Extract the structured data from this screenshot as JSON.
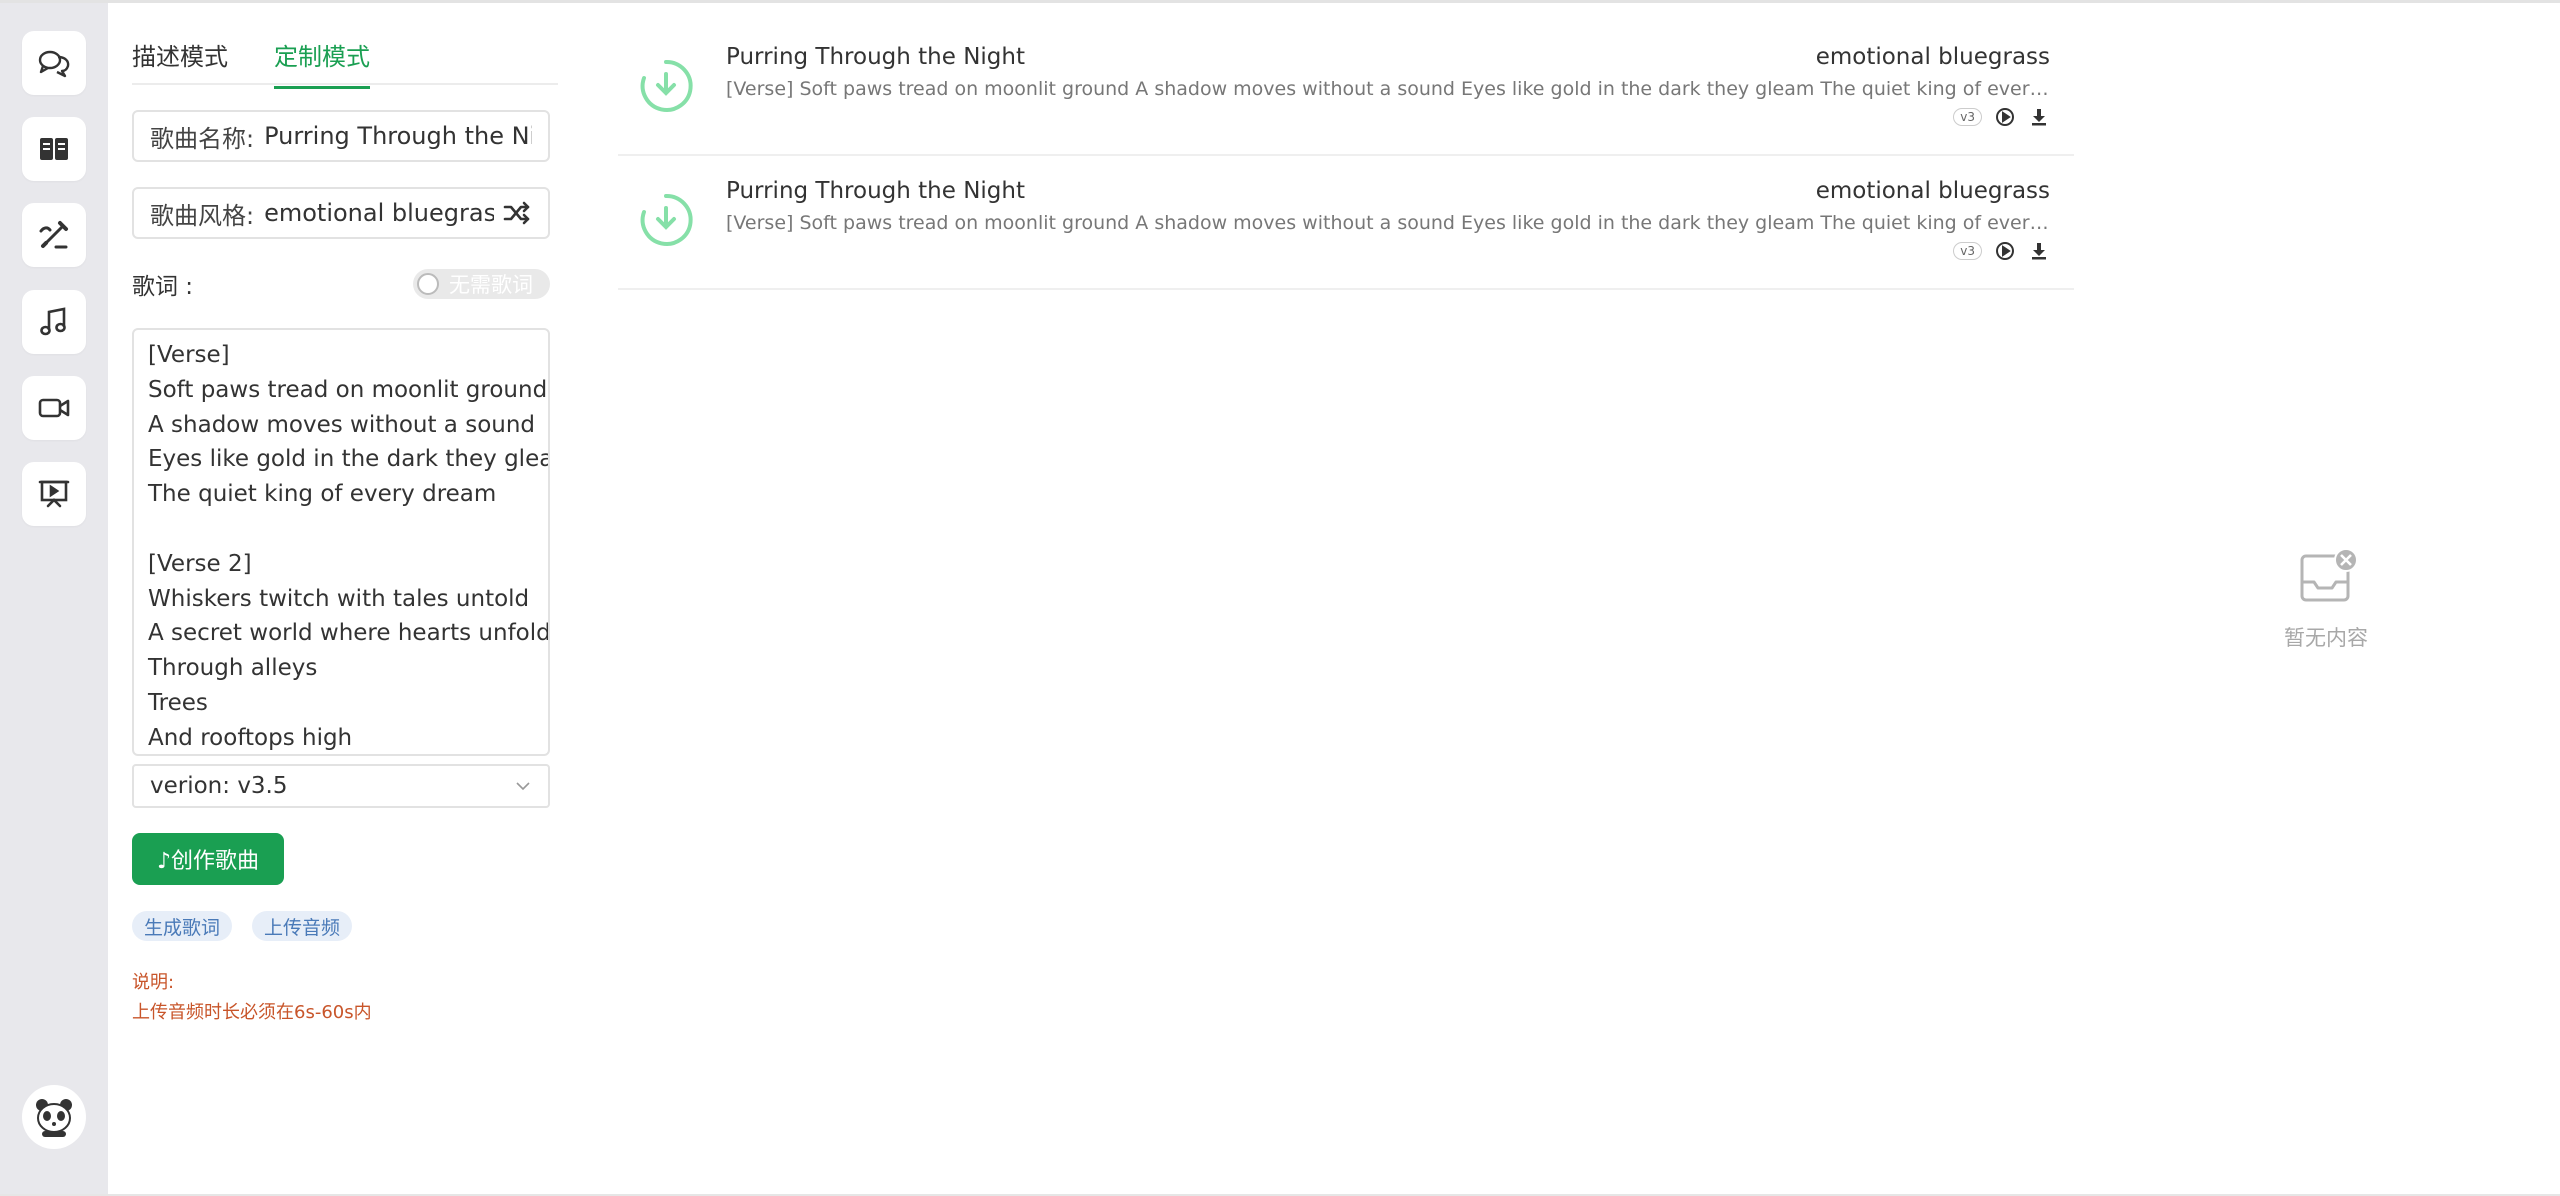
{
  "sidebar": {
    "items": [
      {
        "name": "chat-icon"
      },
      {
        "name": "book-icon"
      },
      {
        "name": "pen-icon"
      },
      {
        "name": "music-icon"
      },
      {
        "name": "video-icon"
      },
      {
        "name": "presentation-icon"
      }
    ],
    "avatar": "panda-avatar-icon"
  },
  "tabs": [
    {
      "label": "描述模式",
      "active": false
    },
    {
      "label": "定制模式",
      "active": true
    }
  ],
  "form": {
    "song_name_label": "歌曲名称:",
    "song_name_value": "Purring Through the Nigh",
    "song_style_label": "歌曲风格:",
    "song_style_value": "emotional bluegrass",
    "lyrics_label": "歌词 :",
    "no_lyrics_toggle": "无需歌词",
    "lyrics_lines": [
      "[Verse]",
      "Soft paws tread on moonlit ground",
      "A shadow moves without a sound",
      "Eyes like gold in the dark they gleam",
      "The quiet king of every dream",
      "",
      "[Verse 2]",
      "Whiskers twitch with tales untold",
      "A secret world where hearts unfold",
      "Through alleys",
      "Trees",
      "And rooftops high"
    ],
    "version": "verion: v3.5",
    "create_button": "♪创作歌曲",
    "chips": [
      "生成歌词",
      "上传音频"
    ],
    "note_title": "说明:",
    "note_text": "上传音频时长必须在6s-60s内"
  },
  "songs": [
    {
      "title": "Purring Through the Night",
      "style": "emotional bluegrass",
      "lyrics": "[Verse] Soft paws tread on moonlit ground A shadow moves without a sound Eyes like gold in the dark they gleam The quiet king of every dream...",
      "badge": "v3"
    },
    {
      "title": "Purring Through the Night",
      "style": "emotional bluegrass",
      "lyrics": "[Verse] Soft paws tread on moonlit ground A shadow moves without a sound Eyes like gold in the dark they gleam The quiet king of every dream...",
      "badge": "v3"
    }
  ],
  "empty_state": {
    "text": "暂无内容"
  },
  "colors": {
    "accent": "#1a9f52",
    "rail_bg": "#e8e8ec",
    "download_ring": "#86e0a8",
    "note": "#c8552a"
  }
}
